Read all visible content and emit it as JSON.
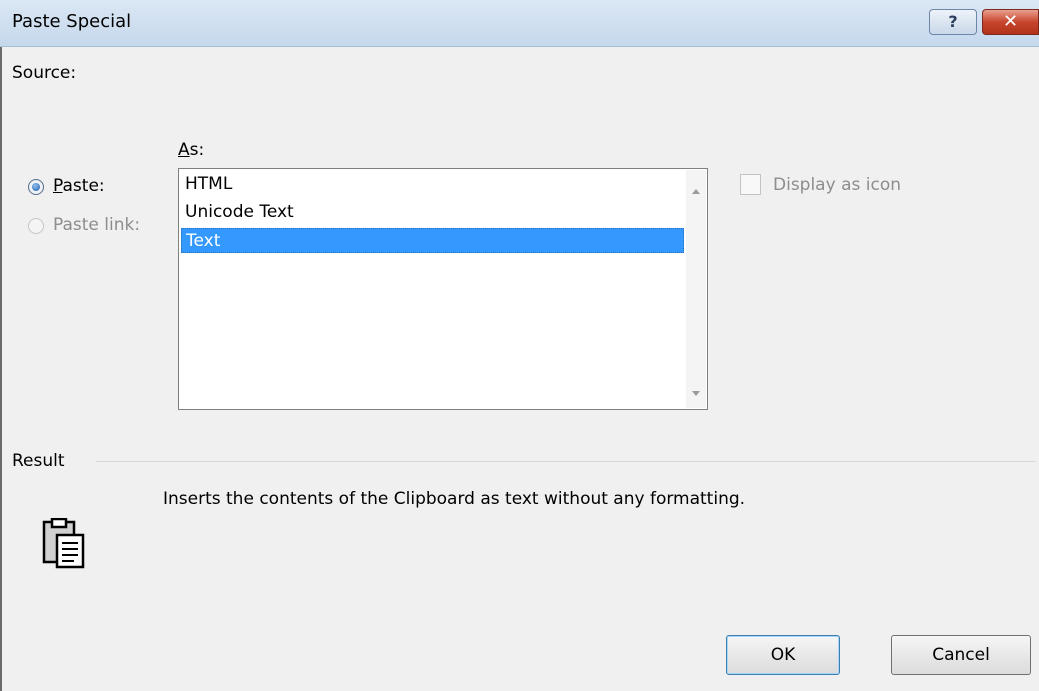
{
  "window": {
    "title": "Paste Special",
    "help_glyph": "?",
    "close_glyph": "✕"
  },
  "source": {
    "label": "Source:"
  },
  "as_label": "As:",
  "options": {
    "paste_label": "Paste:",
    "paste_link_label": "Paste link:",
    "selected": "paste"
  },
  "formats": {
    "items": [
      "HTML",
      "Unicode Text",
      "Text"
    ],
    "selected_index": 2
  },
  "display_as_icon": {
    "label": "Display as icon",
    "checked": false,
    "enabled": false
  },
  "result": {
    "label": "Result",
    "description": "Inserts the contents of the Clipboard as text without any formatting.",
    "icon": "clipboard-paste-icon"
  },
  "buttons": {
    "ok": "OK",
    "cancel": "Cancel"
  },
  "colors": {
    "selection": "#3399ff",
    "titlebar": "#c5d8ec",
    "close": "#c7452c"
  }
}
